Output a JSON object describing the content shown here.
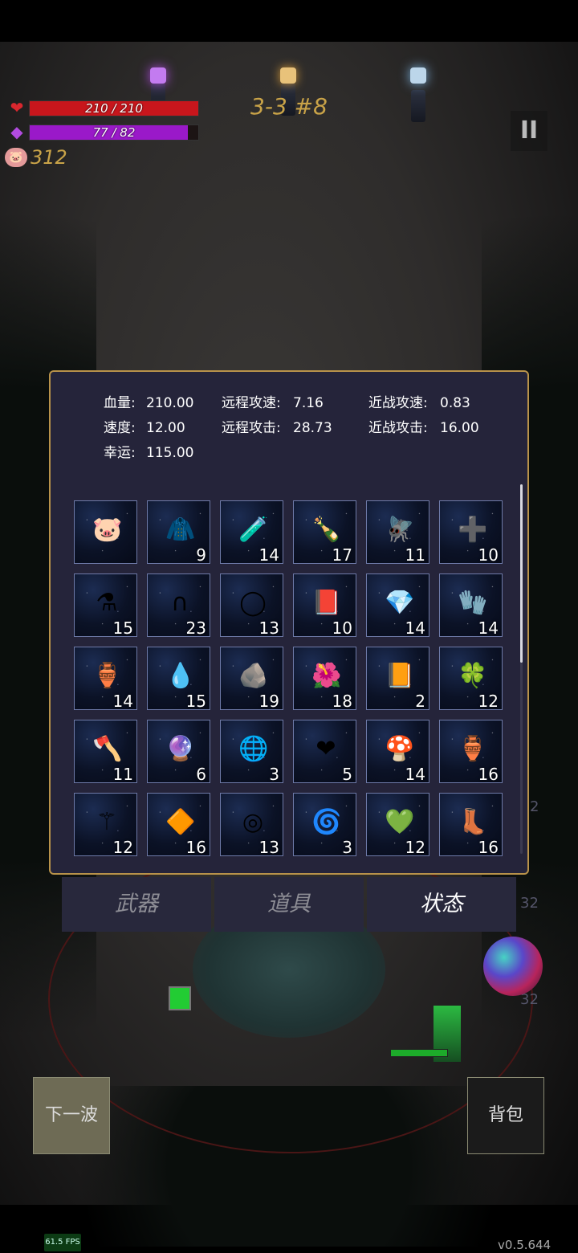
{
  "hud": {
    "hp_text": "210 / 210",
    "hp_fraction": 1.0,
    "mp_text": "77 / 82",
    "mp_fraction": 0.94,
    "coins": "312",
    "stage": "3-3 #8",
    "pause_glyph": "II",
    "hp_color": "#c8161c",
    "mp_color": "#9a19c9"
  },
  "stats": [
    {
      "label": "血量:",
      "value": "210.00"
    },
    {
      "label": "远程攻速:",
      "value": "7.16"
    },
    {
      "label": "近战攻速:",
      "value": "0.83"
    },
    {
      "label": "速度:",
      "value": "12.00"
    },
    {
      "label": "远程攻击:",
      "value": "28.73"
    },
    {
      "label": "近战攻击:",
      "value": "16.00"
    },
    {
      "label": "幸运:",
      "value": "115.00"
    }
  ],
  "inventory": [
    {
      "icon": "piggy-bank-icon",
      "glyph": "🐷",
      "count": ""
    },
    {
      "icon": "cloak-figure-icon",
      "glyph": "🧥",
      "count": "9"
    },
    {
      "icon": "purple-vial-icon",
      "glyph": "🧪",
      "count": "14"
    },
    {
      "icon": "bottle-icon",
      "glyph": "🍾",
      "count": "17"
    },
    {
      "icon": "dragonfly-icon",
      "glyph": "🪰",
      "count": "11"
    },
    {
      "icon": "medkit-icon",
      "glyph": "➕",
      "count": "10"
    },
    {
      "icon": "green-potion-icon",
      "glyph": "⚗",
      "count": "15"
    },
    {
      "icon": "horseshoe-icon",
      "glyph": "∩",
      "count": "23"
    },
    {
      "icon": "thorn-wreath-icon",
      "glyph": "◯",
      "count": "13"
    },
    {
      "icon": "spellbook-icon",
      "glyph": "📕",
      "count": "10"
    },
    {
      "icon": "blue-crystal-icon",
      "glyph": "💎",
      "count": "14"
    },
    {
      "icon": "gloves-icon",
      "glyph": "🧤",
      "count": "14"
    },
    {
      "icon": "flask-icon",
      "glyph": "🏺",
      "count": "14"
    },
    {
      "icon": "water-drop-icon",
      "glyph": "💧",
      "count": "15"
    },
    {
      "icon": "stone-icon",
      "glyph": "🪨",
      "count": "19"
    },
    {
      "icon": "flower-icon",
      "glyph": "🌺",
      "count": "18"
    },
    {
      "icon": "golden-book-icon",
      "glyph": "📙",
      "count": "2"
    },
    {
      "icon": "clover-icon",
      "glyph": "🍀",
      "count": "12"
    },
    {
      "icon": "axe-icon",
      "glyph": "🪓",
      "count": "11"
    },
    {
      "icon": "purple-gem-icon",
      "glyph": "🔮",
      "count": "6"
    },
    {
      "icon": "rainbow-orb-icon",
      "glyph": "🌐",
      "count": "3"
    },
    {
      "icon": "heart-potion-icon",
      "glyph": "❤",
      "count": "5"
    },
    {
      "icon": "mushroom-icon",
      "glyph": "🍄",
      "count": "14"
    },
    {
      "icon": "clay-vase-icon",
      "glyph": "🏺",
      "count": "16"
    },
    {
      "icon": "small-mushroom-icon",
      "glyph": "⚚",
      "count": "12"
    },
    {
      "icon": "yellow-crystal-icon",
      "glyph": "🔶",
      "count": "16"
    },
    {
      "icon": "silver-ring-icon",
      "glyph": "◎",
      "count": "13"
    },
    {
      "icon": "vortex-icon",
      "glyph": "🌀",
      "count": "3"
    },
    {
      "icon": "green-crystal-icon",
      "glyph": "💚",
      "count": "12"
    },
    {
      "icon": "boots-icon",
      "glyph": "👢",
      "count": "16"
    }
  ],
  "tabs": [
    {
      "label": "武器",
      "active": false
    },
    {
      "label": "道具",
      "active": false
    },
    {
      "label": "状态",
      "active": true
    }
  ],
  "buttons": {
    "next_wave": "下一波",
    "backpack": "背包"
  },
  "side_numbers": [
    "2",
    "32",
    "32"
  ],
  "fps": "61.5 FPS",
  "version": "v0.5.644",
  "colors": {
    "panel_bg": "#25243a",
    "panel_border": "#b8924a",
    "accent_gold": "#c9a348"
  }
}
